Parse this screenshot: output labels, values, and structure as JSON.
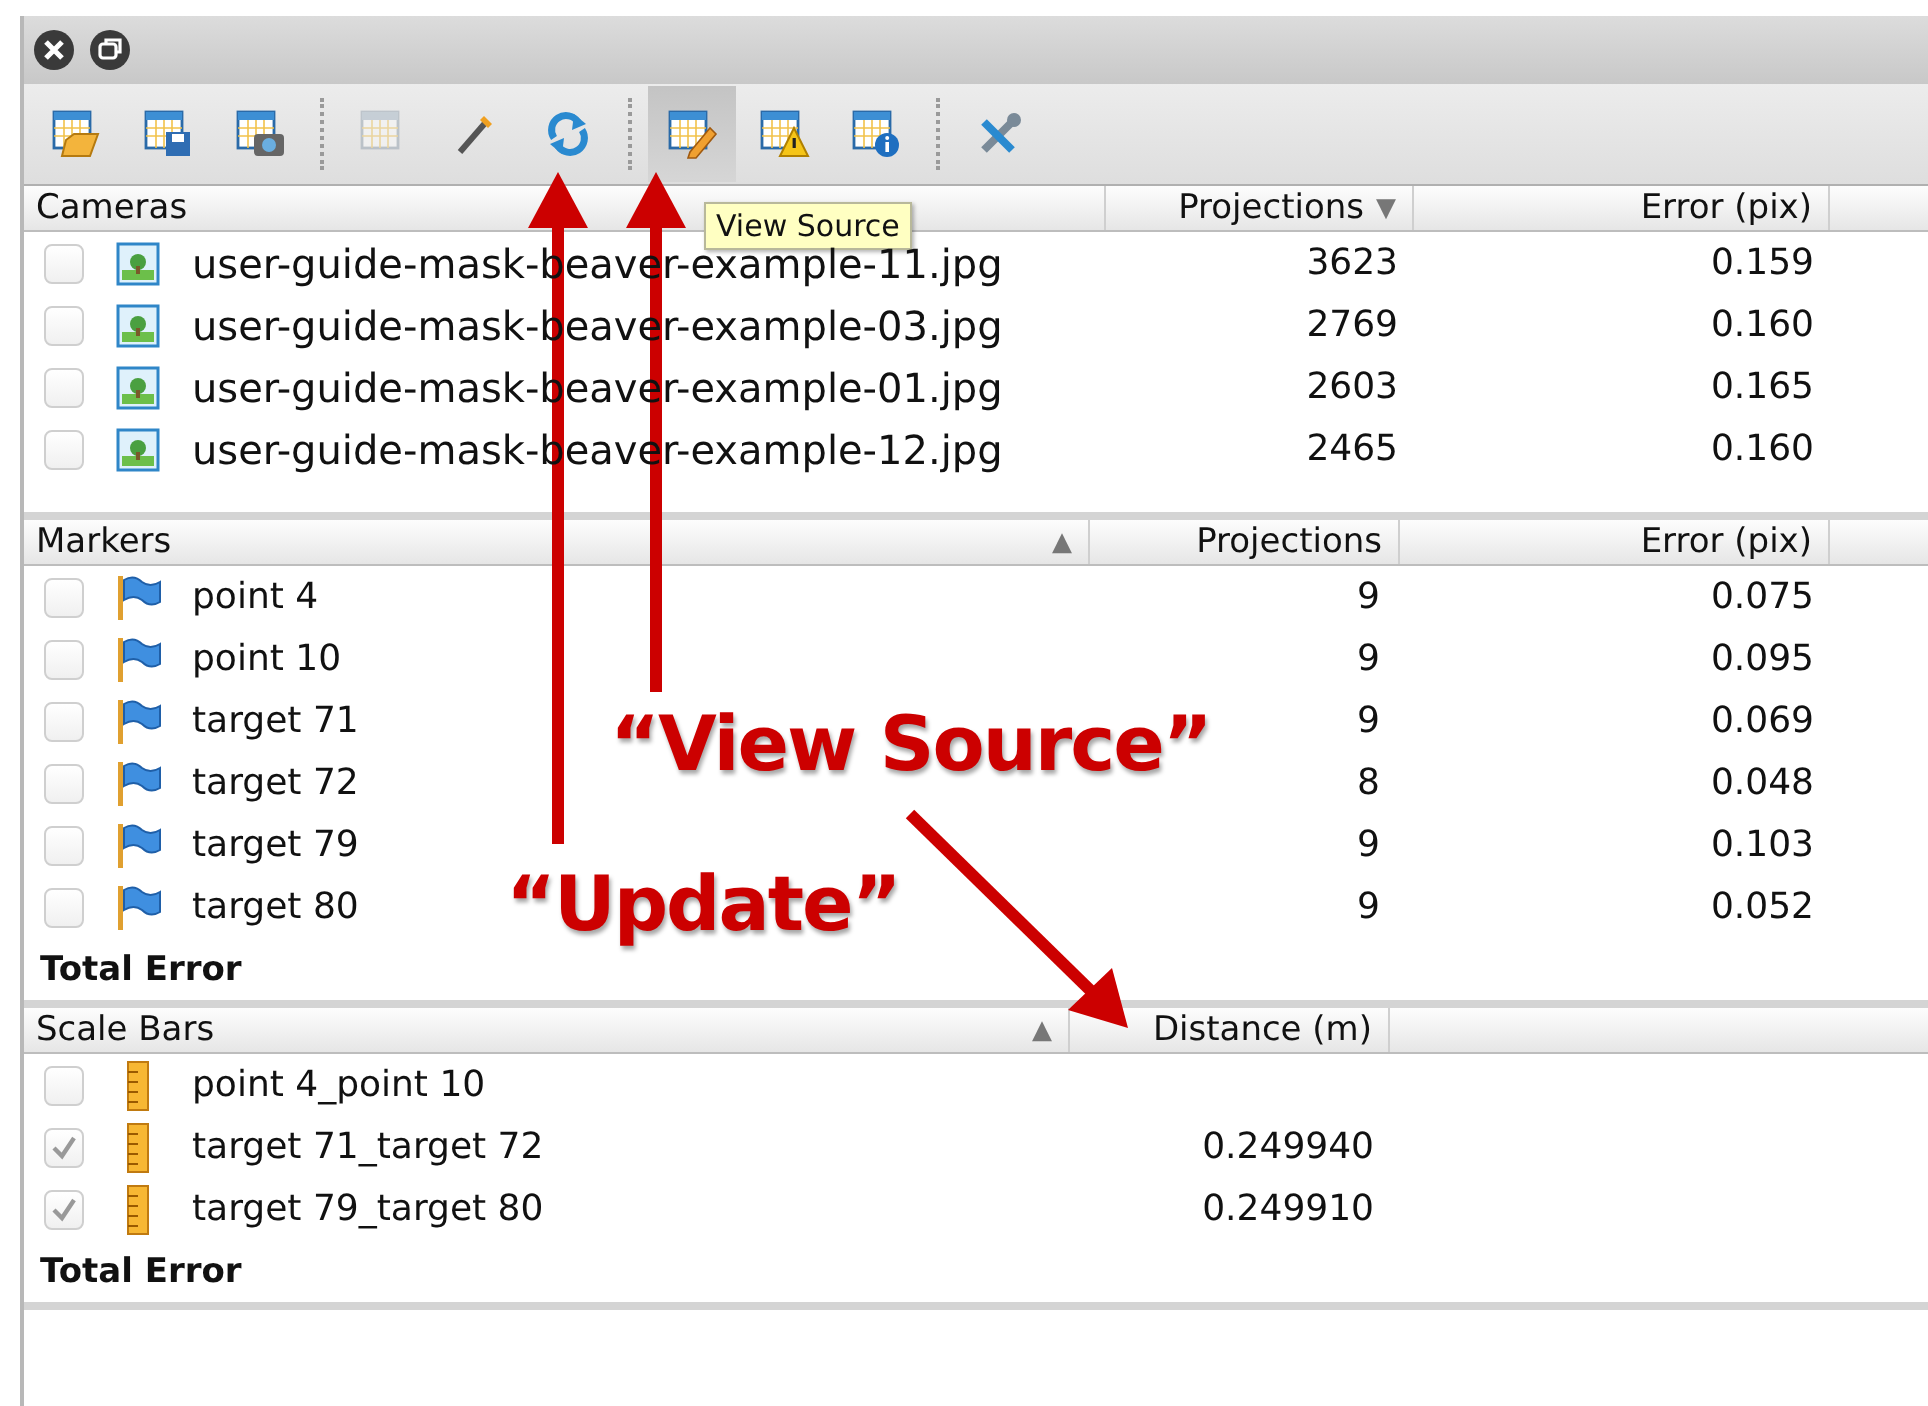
{
  "toolbar": [
    {
      "kind": "button",
      "selected": false,
      "disabled": false
    },
    {
      "kind": "button",
      "selected": false,
      "disabled": false
    },
    {
      "kind": "button",
      "selected": false,
      "disabled": false
    },
    {
      "kind": "separator"
    },
    {
      "kind": "button",
      "selected": false,
      "disabled": true
    },
    {
      "kind": "button",
      "selected": false,
      "disabled": false
    },
    {
      "kind": "button",
      "selected": false,
      "disabled": false
    },
    {
      "kind": "separator"
    },
    {
      "kind": "button",
      "selected": true,
      "disabled": false
    },
    {
      "kind": "button",
      "selected": false,
      "disabled": false
    },
    {
      "kind": "button",
      "selected": false,
      "disabled": false
    },
    {
      "kind": "separator"
    },
    {
      "kind": "button",
      "selected": false,
      "disabled": false
    }
  ],
  "tooltip": {
    "text": "View Source"
  },
  "panels": [
    {
      "columns": [
        {
          "label": "Cameras"
        },
        {
          "label": "Projections",
          "sort_indicator": "▼"
        },
        {
          "label": "Error (pix)"
        }
      ],
      "rows": [
        {
          "checked": false,
          "name": "user-guide-mask-beaver-example-11.jpg",
          "values": [
            "3623",
            "0.159"
          ]
        },
        {
          "checked": false,
          "name": "user-guide-mask-beaver-example-03.jpg",
          "values": [
            "2769",
            "0.160"
          ]
        },
        {
          "checked": false,
          "name": "user-guide-mask-beaver-example-01.jpg",
          "values": [
            "2603",
            "0.165"
          ]
        },
        {
          "checked": false,
          "name": "user-guide-mask-beaver-example-12.jpg",
          "values": [
            "2465",
            "0.160"
          ]
        }
      ]
    },
    {
      "columns": [
        {
          "label": "Markers",
          "sort_indicator": "▲"
        },
        {
          "label": "Projections"
        },
        {
          "label": "Error (pix)"
        }
      ],
      "rows": [
        {
          "checked": false,
          "name": "point 4",
          "values": [
            "9",
            "0.075"
          ]
        },
        {
          "checked": false,
          "name": "point 10",
          "values": [
            "9",
            "0.095"
          ]
        },
        {
          "checked": false,
          "name": "target 71",
          "values": [
            "9",
            "0.069"
          ]
        },
        {
          "checked": false,
          "name": "target 72",
          "values": [
            "8",
            "0.048"
          ]
        },
        {
          "checked": false,
          "name": "target 79",
          "values": [
            "9",
            "0.103"
          ]
        },
        {
          "checked": false,
          "name": "target 80",
          "values": [
            "9",
            "0.052"
          ]
        }
      ],
      "total": "Total Error"
    },
    {
      "columns": [
        {
          "label": "Scale Bars",
          "sort_indicator": "▲"
        },
        {
          "label": "Distance (m)"
        }
      ],
      "rows": [
        {
          "checked": false,
          "name": "point 4_point 10",
          "values": []
        },
        {
          "checked": true,
          "name": "target 71_target 72",
          "values": [
            "0.249940"
          ]
        },
        {
          "checked": true,
          "name": "target 79_target 80",
          "values": [
            "0.249910"
          ]
        }
      ],
      "total": "Total Error"
    }
  ],
  "annotations": [
    {
      "text": "“View Source”"
    },
    {
      "text": "“Update”"
    }
  ]
}
